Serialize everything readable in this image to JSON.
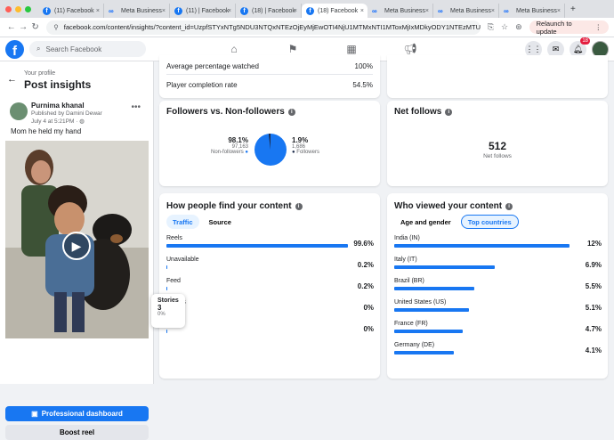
{
  "browser": {
    "tabs": [
      {
        "label": "(11) Facebook",
        "icon": "facebook-icon"
      },
      {
        "label": "Meta Business",
        "icon": "meta-icon"
      },
      {
        "label": "(11) | Facebook",
        "icon": "facebook-icon"
      },
      {
        "label": "(18) | Facebook",
        "icon": "facebook-icon"
      },
      {
        "label": "(18) Facebook",
        "icon": "facebook-icon",
        "active": true
      },
      {
        "label": "Meta Business",
        "icon": "meta-icon"
      },
      {
        "label": "Meta Business",
        "icon": "meta-icon"
      },
      {
        "label": "Meta Business",
        "icon": "meta-icon"
      }
    ],
    "url": "facebook.com/content/insights/?content_id=UzpfSTYxNTg5NDU3NTQxNTEzOjEyMjEwOTI4NjU1MTMxNTI1MToxMjIxMDkyODY1NTEzMTUyNTE%3D...",
    "relaunch_label": "Relaunch to update"
  },
  "fb": {
    "search_placeholder": "Search Facebook",
    "notification_count": "18"
  },
  "left": {
    "subtitle": "Your profile",
    "title": "Post insights",
    "post": {
      "author": "Purnima khanal",
      "published_by": "Published by Damini Dewar",
      "date": "July 4 at 5:21PM · ",
      "caption": "Mom he held my hand"
    },
    "professional_dashboard": "Professional dashboard",
    "boost_reel": "Boost reel"
  },
  "tooltip": {
    "label": "Stories",
    "value": "3",
    "pct": "0%"
  },
  "watch": {
    "avg_label": "Average percentage watched",
    "avg_value": "100%",
    "completion_label": "Player completion rate",
    "completion_value": "54.5%"
  },
  "followers": {
    "title": "Followers vs. Non-followers",
    "nonfollowers_pct": "98.1%",
    "nonfollowers_count": "97,163",
    "nonfollowers_label": "Non-followers",
    "followers_pct": "1.9%",
    "followers_count": "1,686",
    "followers_label": "Followers",
    "share": [
      98.1,
      1.9
    ]
  },
  "netfollows": {
    "title": "Net follows",
    "value": "512",
    "label": "Net follows"
  },
  "find": {
    "title": "How people find your content",
    "tabs": [
      "Traffic",
      "Source"
    ],
    "rows": [
      {
        "label": "Reels",
        "value": "99.6%",
        "frac": 0.996
      },
      {
        "label": "Unavailable",
        "value": "0.2%",
        "frac": 0.002
      },
      {
        "label": "Feed",
        "value": "0.2%",
        "frac": 0.002
      },
      {
        "label": "Stories",
        "value": "0%",
        "frac": 0
      },
      {
        "label": "",
        "value": "0%",
        "frac": 0
      }
    ]
  },
  "who": {
    "title": "Who viewed your content",
    "tabs": [
      "Age and gender",
      "Top countries"
    ],
    "rows": [
      {
        "label": "India (IN)",
        "value": "12%",
        "frac": 0.12
      },
      {
        "label": "Italy (IT)",
        "value": "6.9%",
        "frac": 0.069
      },
      {
        "label": "Brazil (BR)",
        "value": "5.5%",
        "frac": 0.055
      },
      {
        "label": "United States (US)",
        "value": "5.1%",
        "frac": 0.051
      },
      {
        "label": "France (FR)",
        "value": "4.7%",
        "frac": 0.047
      },
      {
        "label": "Germany (DE)",
        "value": "4.1%",
        "frac": 0.041
      }
    ]
  }
}
